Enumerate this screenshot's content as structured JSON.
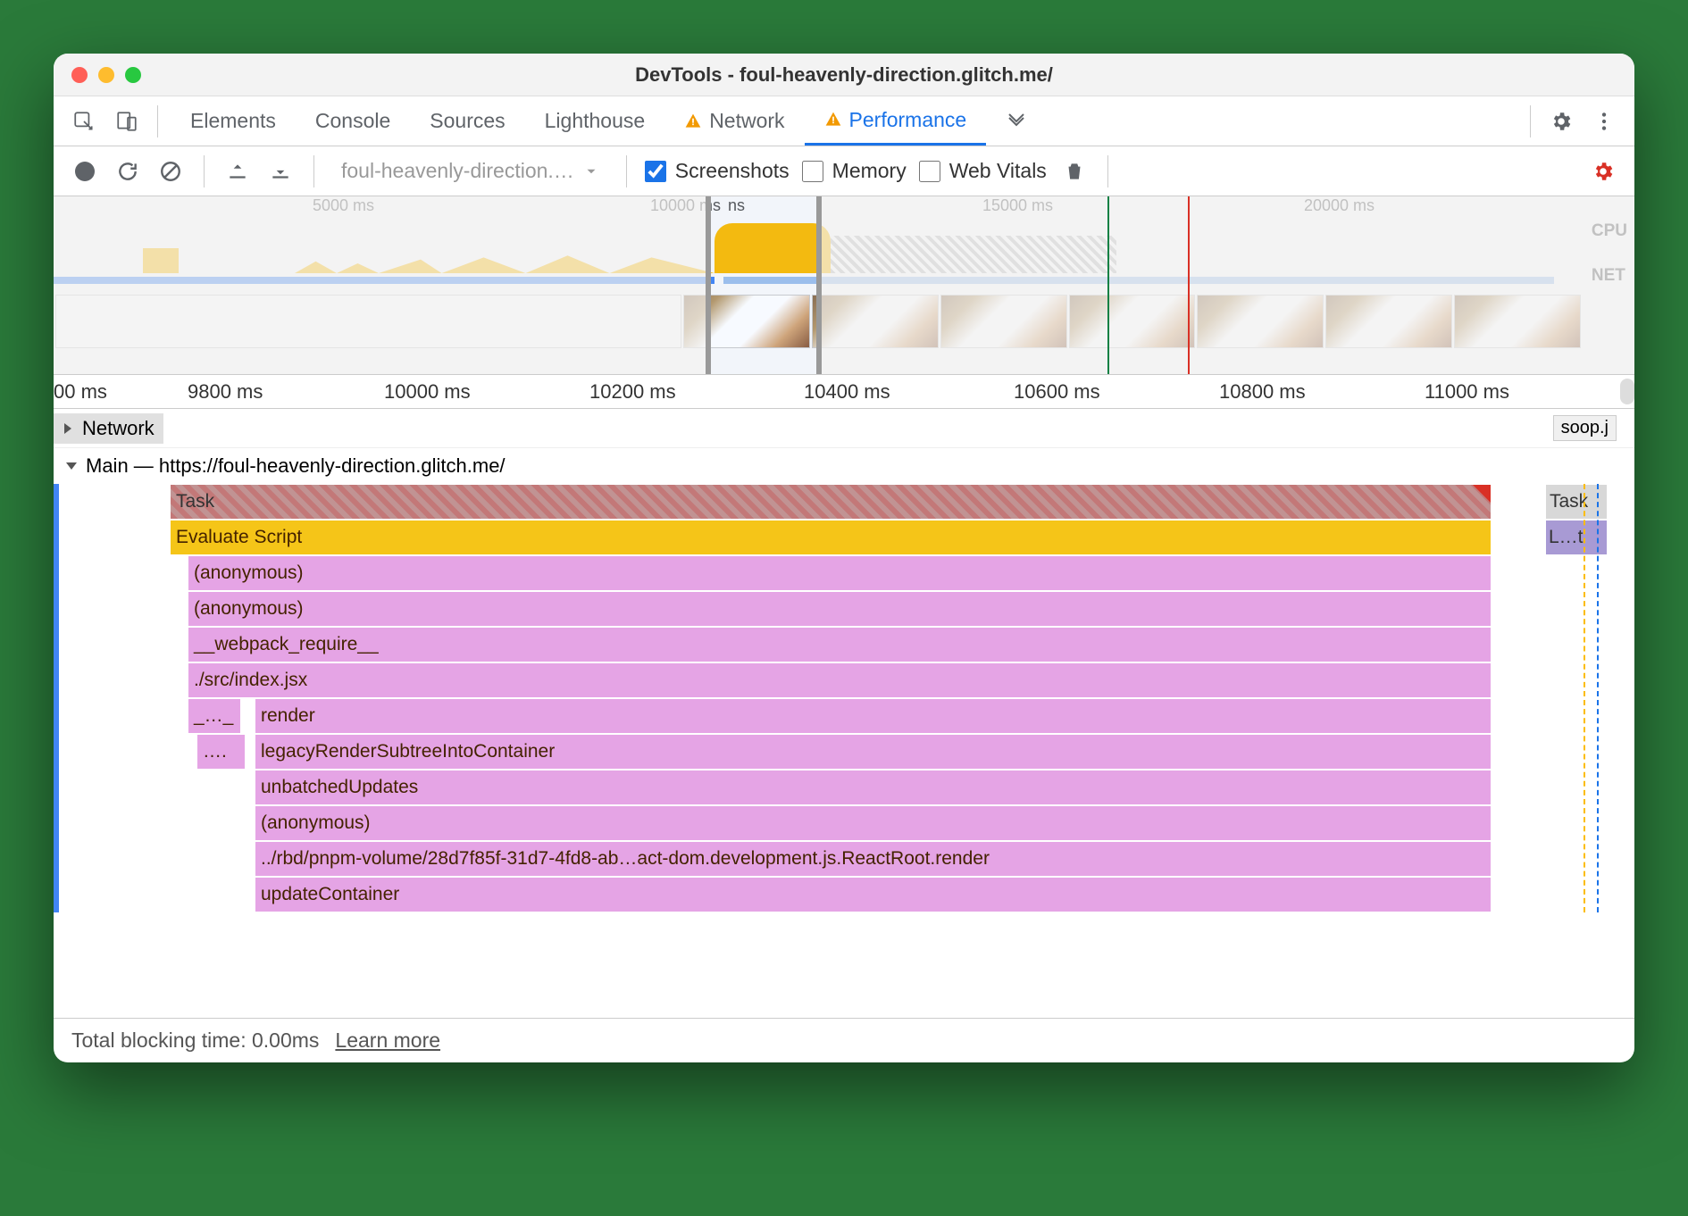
{
  "window": {
    "title": "DevTools - foul-heavenly-direction.glitch.me/"
  },
  "tabs": {
    "elements": "Elements",
    "console": "Console",
    "sources": "Sources",
    "lighthouse": "Lighthouse",
    "network": "Network",
    "performance": "Performance"
  },
  "toolbar": {
    "profile": "foul-heavenly-direction.…",
    "screenshots": "Screenshots",
    "memory": "Memory",
    "webvitals": "Web Vitals"
  },
  "overview_ticks": {
    "t1": "5000 ms",
    "t2": "10000 ms",
    "t2b": "ns",
    "t3": "15000 ms",
    "t4": "20000 ms"
  },
  "overview_labels": {
    "cpu": "CPU",
    "net": "NET"
  },
  "ruler": {
    "r0": "00 ms",
    "r1": "9800 ms",
    "r2": "10000 ms",
    "r3": "10200 ms",
    "r4": "10400 ms",
    "r5": "10600 ms",
    "r6": "10800 ms",
    "r7": "11000 ms"
  },
  "tracks": {
    "network": "Network",
    "soop": "soop.j",
    "main": "Main — https://foul-heavenly-direction.glitch.me/"
  },
  "flame": {
    "task": "Task",
    "task2": "Task",
    "eval": "Evaluate Script",
    "lt": "L…t",
    "rows": [
      "(anonymous)",
      "(anonymous)",
      "__webpack_require__",
      "./src/index.jsx",
      "render",
      "legacyRenderSubtreeIntoContainer",
      "unbatchedUpdates",
      "(anonymous)",
      "../rbd/pnpm-volume/28d7f85f-31d7-4fd8-ab…act-dom.development.js.ReactRoot.render",
      "updateContainer"
    ],
    "prefix4": "_…_",
    "prefix5": "…."
  },
  "footer": {
    "tbt": "Total blocking time: 0.00ms",
    "learn": "Learn more"
  }
}
